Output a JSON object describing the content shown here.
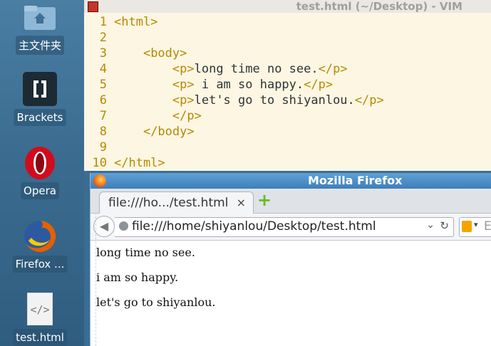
{
  "desktop": {
    "icons": [
      {
        "label": "主文件夹",
        "icon": "folder-icon"
      },
      {
        "label": "Brackets",
        "icon": "brackets-icon"
      },
      {
        "label": "Opera",
        "icon": "opera-icon"
      },
      {
        "label": "Firefox ...",
        "icon": "firefox-icon"
      },
      {
        "label": "test.html",
        "icon": "html-file-icon"
      }
    ]
  },
  "vim": {
    "title": "test.html (~/Desktop) - VIM",
    "lines": [
      {
        "num": "1",
        "code": "<html>"
      },
      {
        "num": "2",
        "code": ""
      },
      {
        "num": "3",
        "code": "    <body>"
      },
      {
        "num": "4",
        "code": "        <p>long time no see.</p>"
      },
      {
        "num": "5",
        "code": "        <p> i am so happy.</p>"
      },
      {
        "num": "6",
        "code": "        <p>let's go to shiyanlou.</p>"
      },
      {
        "num": "7",
        "code": "        </p>"
      },
      {
        "num": "8",
        "code": "    </body>"
      },
      {
        "num": "9",
        "code": ""
      },
      {
        "num": "10",
        "code": "</html>"
      }
    ]
  },
  "firefox": {
    "title": "Mozilla Firefox",
    "tab_label": "file:///ho.../test.html",
    "tab_close": "×",
    "new_tab": "+",
    "url": "file:///home/shiyanlou/Desktop/test.html",
    "search_hint": "E",
    "content": [
      "long time no see.",
      "i am so happy.",
      "let's go to shiyanlou."
    ]
  },
  "colors": {
    "vim_bg": "#fdf6e3",
    "vim_tag": "#b58900",
    "desktop_bg": "#3b6c90",
    "firefox_titlebar": "#3d7fb9"
  }
}
